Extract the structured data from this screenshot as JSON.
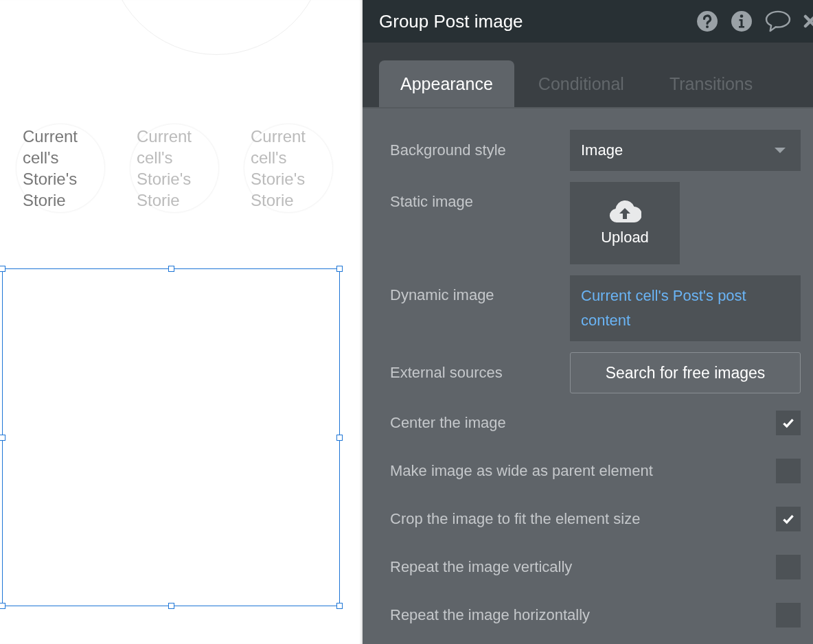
{
  "canvas": {
    "story_circles": [
      {
        "text": "Current cell's Storie's Storie",
        "dimmed": false
      },
      {
        "text": "Current cell's Storie's Storie",
        "dimmed": true
      },
      {
        "text": "Current cell's Storie's Storie",
        "dimmed": true
      }
    ]
  },
  "panel": {
    "title": "Group Post image",
    "tabs": [
      {
        "label": "Appearance",
        "selected": true
      },
      {
        "label": "Conditional",
        "selected": false
      },
      {
        "label": "Transitions",
        "selected": false
      }
    ],
    "rows": [
      {
        "kind": "dropdown",
        "label": "Background style",
        "value": "Image"
      },
      {
        "kind": "upload",
        "label": "Static image",
        "button": "Upload"
      },
      {
        "kind": "dynamic",
        "label": "Dynamic image",
        "value": "Current cell's Post's post content"
      },
      {
        "kind": "button",
        "label": "External sources",
        "button": "Search for free images"
      },
      {
        "kind": "checkbox",
        "label": "Center the image",
        "checked": true
      },
      {
        "kind": "checkbox",
        "label": "Make image as wide as parent element",
        "checked": false
      },
      {
        "kind": "checkbox",
        "label": "Crop the image to fit the element size",
        "checked": true
      },
      {
        "kind": "checkbox",
        "label": "Repeat the image vertically",
        "checked": false
      },
      {
        "kind": "checkbox",
        "label": "Repeat the image horizontally",
        "checked": false
      }
    ]
  }
}
